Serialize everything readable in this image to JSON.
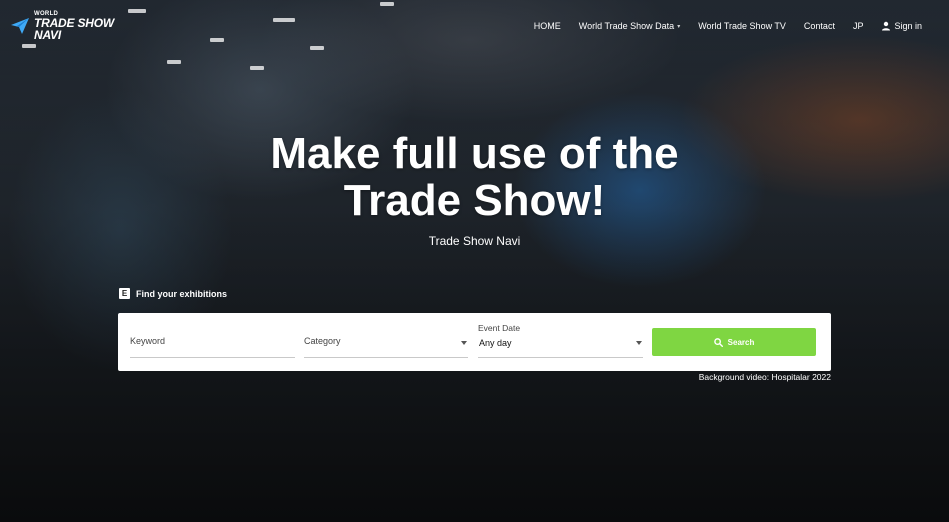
{
  "logo": {
    "small": "WORLD",
    "line1": "TRADE SHOW",
    "line2": "NAVI"
  },
  "nav": {
    "home": "HOME",
    "data": "World Trade Show Data",
    "tv": "World Trade Show TV",
    "contact": "Contact",
    "lang": "JP",
    "signin": "Sign in"
  },
  "hero": {
    "title_line1": "Make full use of the",
    "title_line2": "Trade Show!",
    "subtitle": "Trade Show Navi"
  },
  "search": {
    "section_icon": "E",
    "section_label": "Find your exhibitions",
    "keyword_placeholder": "Keyword",
    "category_placeholder": "Category",
    "date_label": "Event Date",
    "date_value": "Any day",
    "button_label": "Search",
    "accent_color": "#7fd642"
  },
  "credit": "Background video: Hospitalar 2022",
  "icons": {
    "logo": "paper-plane-icon",
    "user": "user-icon",
    "search": "search-icon",
    "dropdown": "chevron-down-icon"
  }
}
